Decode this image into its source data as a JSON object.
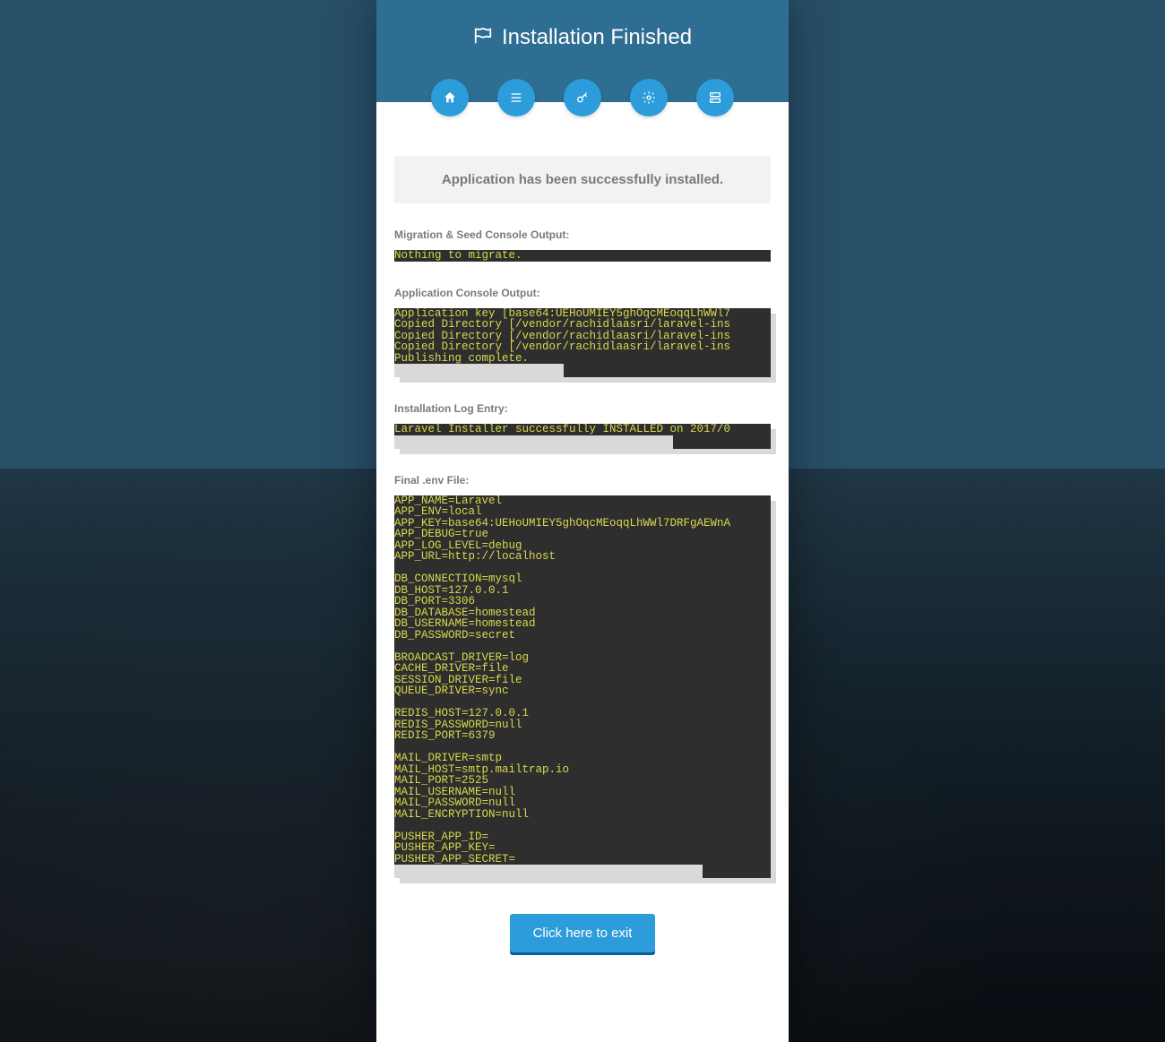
{
  "header": {
    "title": "Installation Finished"
  },
  "steps": [
    {
      "name": "home-icon"
    },
    {
      "name": "list-icon"
    },
    {
      "name": "key-icon"
    },
    {
      "name": "gear-icon"
    },
    {
      "name": "server-icon"
    }
  ],
  "alert_message": "Application has been successfully installed.",
  "sections": {
    "migration": {
      "label": "Migration & Seed Console Output:",
      "content": "Nothing to migrate."
    },
    "app_output": {
      "label": "Application Console Output:",
      "content": "Application key [base64:UEHoUMIEY5ghOqcMEoqqLhWWl7\nCopied Directory [/vendor/rachidlaasri/laravel-ins\nCopied Directory [/vendor/rachidlaasri/laravel-ins\nCopied Directory [/vendor/rachidlaasri/laravel-ins\nPublishing complete."
    },
    "log_entry": {
      "label": "Installation Log Entry:",
      "content": "Laravel Installer successfully INSTALLED on 2017/0"
    },
    "env_file": {
      "label": "Final .env File:",
      "content": "APP_NAME=Laravel\nAPP_ENV=local\nAPP_KEY=base64:UEHoUMIEY5ghOqcMEoqqLhWWl7DRFgAEWnA\nAPP_DEBUG=true\nAPP_LOG_LEVEL=debug\nAPP_URL=http://localhost\n\nDB_CONNECTION=mysql\nDB_HOST=127.0.0.1\nDB_PORT=3306\nDB_DATABASE=homestead\nDB_USERNAME=homestead\nDB_PASSWORD=secret\n\nBROADCAST_DRIVER=log\nCACHE_DRIVER=file\nSESSION_DRIVER=file\nQUEUE_DRIVER=sync\n\nREDIS_HOST=127.0.0.1\nREDIS_PASSWORD=null\nREDIS_PORT=6379\n\nMAIL_DRIVER=smtp\nMAIL_HOST=smtp.mailtrap.io\nMAIL_PORT=2525\nMAIL_USERNAME=null\nMAIL_PASSWORD=null\nMAIL_ENCRYPTION=null\n\nPUSHER_APP_ID=\nPUSHER_APP_KEY=\nPUSHER_APP_SECRET="
    }
  },
  "cta_label": "Click here to exit",
  "colors": {
    "accent": "#2d9cdb",
    "header": "#2f6e93",
    "code_fg": "#d8d84d",
    "code_bg": "#2e2e2e"
  }
}
